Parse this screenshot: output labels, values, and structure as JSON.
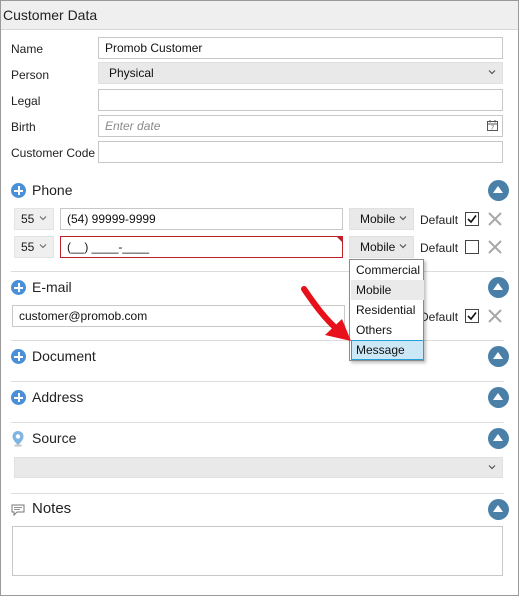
{
  "window": {
    "title": "Customer Data"
  },
  "form": {
    "name_label": "Name",
    "name_value": "Promob Customer",
    "person_label": "Person",
    "person_value": "Physical",
    "legal_label": "Legal",
    "legal_value": "",
    "birth_label": "Birth",
    "birth_placeholder": "Enter date",
    "code_label": "Customer Code",
    "code_value": ""
  },
  "phone": {
    "title": "Phone",
    "default_label": "Default",
    "rows": [
      {
        "code": "55",
        "number": "(54) 99999-9999",
        "type": "Mobile",
        "default": true
      },
      {
        "code": "55",
        "number": "(__) ____-____",
        "type": "Mobile",
        "default": false
      }
    ],
    "dropdown_options": [
      "Commercial",
      "Mobile",
      "Residential",
      "Others",
      "Message"
    ],
    "dropdown_selected": "Mobile",
    "dropdown_hovered": "Message"
  },
  "email": {
    "title": "E-mail",
    "value": "customer@promob.com",
    "default_label": "Default",
    "default": true
  },
  "document": {
    "title": "Document"
  },
  "address": {
    "title": "Address"
  },
  "source": {
    "title": "Source",
    "value": ""
  },
  "notes": {
    "title": "Notes",
    "value": ""
  },
  "colors": {
    "accent": "#4a90d9",
    "collapse": "#4a7fa8",
    "error_border": "#c0202a",
    "arrow": "#e8101a",
    "highlight": "#cce8f6"
  },
  "icons": {
    "section_add": "plus-circle-icon",
    "collapse": "chevron-up-circle-icon",
    "remove": "close-icon",
    "calendar": "calendar-icon",
    "source": "map-pin-icon",
    "notes": "speech-bubble-icon"
  }
}
